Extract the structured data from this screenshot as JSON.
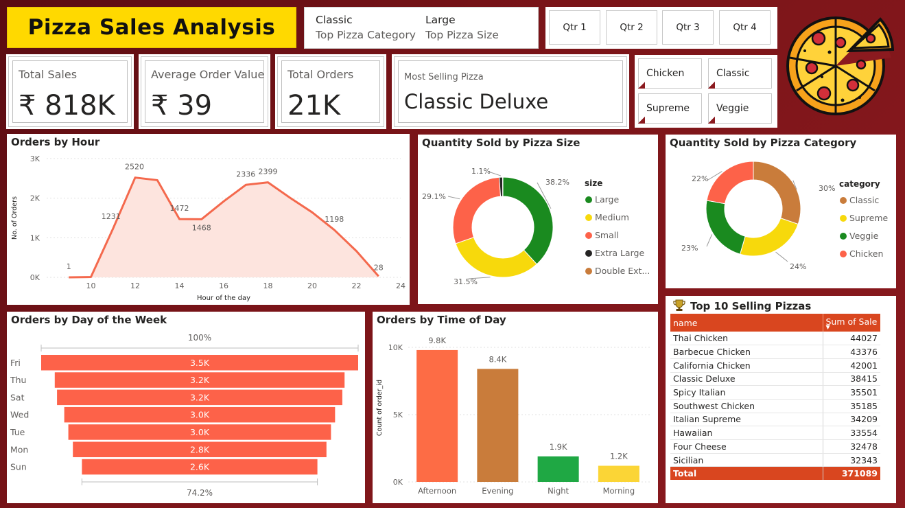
{
  "header": {
    "title": "Pizza Sales Analysis",
    "top_category_value": "Classic",
    "top_category_label": "Top Pizza Category",
    "top_size_value": "Large",
    "top_size_label": "Top Pizza Size"
  },
  "quarters": [
    "Qtr 1",
    "Qtr 2",
    "Qtr 3",
    "Qtr 4"
  ],
  "kpis": {
    "total_sales": {
      "label": "Total Sales",
      "value": "₹ 818K"
    },
    "avg_order": {
      "label": "Average Order Value",
      "value": "₹ 39"
    },
    "total_orders": {
      "label": "Total Orders",
      "value": "21K"
    },
    "most_selling": {
      "label": "Most Selling Pizza",
      "value": "Classic Deluxe"
    }
  },
  "category_filters": [
    "Chicken",
    "Classic",
    "Supreme",
    "Veggie"
  ],
  "colors": {
    "accent_red": "#d9461f",
    "title_yellow": "#ffd900",
    "line": "#f4694d",
    "funnel": "#fd6249",
    "green": "#1a8a1f",
    "yellow": "#f7d90c",
    "orange": "#fd6249",
    "dark": "#252423",
    "brown": "#c97c3b"
  },
  "chart_data": [
    {
      "id": "orders_by_hour",
      "type": "area",
      "title": "Orders by Hour",
      "xlabel": "Hour of the day",
      "ylabel": "No. of Orders",
      "x": [
        9,
        10,
        11,
        12,
        13,
        14,
        15,
        16,
        17,
        18,
        19,
        20,
        21,
        22,
        23
      ],
      "values": [
        1,
        8,
        1231,
        2520,
        2455,
        1472,
        1468,
        1920,
        2336,
        2399,
        2010,
        1642,
        1198,
        663,
        28
      ],
      "data_labels": {
        "9": "1",
        "11": "1231",
        "12": "2520",
        "14": "1472",
        "15": "1468",
        "17": "2336",
        "18": "2399",
        "21": "1198",
        "23": "28"
      },
      "xticks": [
        10,
        12,
        14,
        16,
        18,
        20,
        22,
        24
      ],
      "yticks": [
        0,
        1000,
        2000,
        3000
      ],
      "ytick_labels": [
        "0K",
        "1K",
        "2K",
        "3K"
      ],
      "xlim": [
        8,
        24
      ],
      "ylim": [
        0,
        3000
      ]
    },
    {
      "id": "qty_by_size",
      "type": "pie",
      "donut": true,
      "title": "Quantity Sold by Pizza Size",
      "legend_title": "size",
      "legend_position": "right",
      "labels": [
        "Large",
        "Medium",
        "Small",
        "Extra Large",
        "Double Ext..."
      ],
      "values": [
        38.2,
        31.5,
        29.1,
        1.1,
        0.1
      ],
      "value_labels": [
        "38.2%",
        "31.5%",
        "29.1%",
        "1.1%",
        ""
      ],
      "colors": [
        "#1a8a1f",
        "#f7d90c",
        "#fd6249",
        "#252423",
        "#c97c3b"
      ]
    },
    {
      "id": "qty_by_category",
      "type": "pie",
      "donut": true,
      "title": "Quantity Sold by Pizza Category",
      "legend_title": "category",
      "legend_position": "right",
      "labels": [
        "Classic",
        "Supreme",
        "Veggie",
        "Chicken"
      ],
      "values": [
        30,
        24,
        23,
        22
      ],
      "value_labels": [
        "30%",
        "24%",
        "23%",
        "22%"
      ],
      "colors": [
        "#c97c3b",
        "#f7d90c",
        "#1a8a1f",
        "#fd6249"
      ]
    },
    {
      "id": "orders_by_day",
      "type": "bar",
      "orientation": "funnel",
      "title": "Orders by Day of the Week",
      "categories": [
        "Fri",
        "Thu",
        "Sat",
        "Wed",
        "Tue",
        "Mon",
        "Sun"
      ],
      "values": [
        3500,
        3200,
        3150,
        2990,
        2900,
        2800,
        2600
      ],
      "value_labels": [
        "3.5K",
        "3.2K",
        "3.2K",
        "3.0K",
        "3.0K",
        "2.8K",
        "2.6K"
      ],
      "top_label": "100%",
      "bottom_label": "74.2%"
    },
    {
      "id": "orders_by_time",
      "type": "bar",
      "title": "Orders by Time of Day",
      "ylabel": "Count of order_id",
      "categories": [
        "Afternoon",
        "Evening",
        "Night",
        "Morning"
      ],
      "values": [
        9800,
        8400,
        1900,
        1200
      ],
      "value_labels": [
        "9.8K",
        "8.4K",
        "1.9K",
        "1.2K"
      ],
      "colors": [
        "#fd6c45",
        "#c97c3b",
        "#1fa844",
        "#fbd536"
      ],
      "yticks": [
        0,
        5000,
        10000
      ],
      "ytick_labels": [
        "0K",
        "5K",
        "10K"
      ],
      "ylim": [
        0,
        10000
      ]
    }
  ],
  "top10": {
    "title": "Top 10 Selling Pizzas",
    "columns": [
      "name",
      "Sum of Sale"
    ],
    "rows": [
      {
        "name": "Thai Chicken",
        "sale": "44027"
      },
      {
        "name": "Barbecue Chicken",
        "sale": "43376"
      },
      {
        "name": "California Chicken",
        "sale": "42001"
      },
      {
        "name": "Classic Deluxe",
        "sale": "38415"
      },
      {
        "name": "Spicy Italian",
        "sale": "35501"
      },
      {
        "name": "Southwest Chicken",
        "sale": "35185"
      },
      {
        "name": "Italian Supreme",
        "sale": "34209"
      },
      {
        "name": "Hawaiian",
        "sale": "33554"
      },
      {
        "name": "Four Cheese",
        "sale": "32478"
      },
      {
        "name": "Sicilian",
        "sale": "32343"
      }
    ],
    "total_label": "Total",
    "total_value": "371089"
  }
}
